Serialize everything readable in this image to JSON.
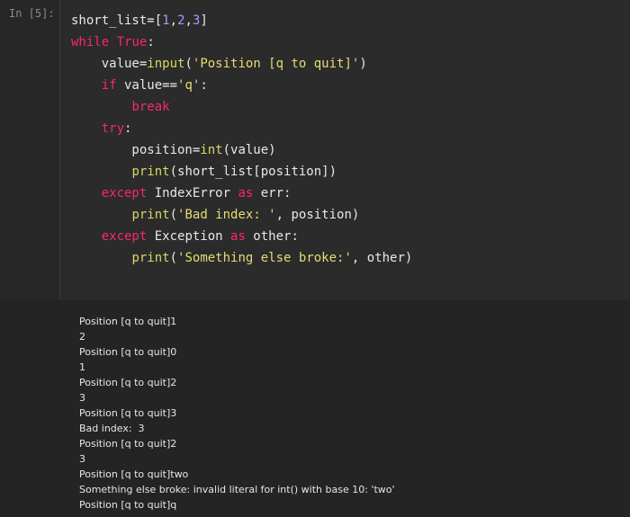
{
  "cell": {
    "prompt": "In [5]:",
    "code_lines": [
      [
        {
          "t": "short_list",
          "c": "plain"
        },
        {
          "t": "=",
          "c": "op"
        },
        {
          "t": "[",
          "c": "plain"
        },
        {
          "t": "1",
          "c": "num"
        },
        {
          "t": ",",
          "c": "plain"
        },
        {
          "t": "2",
          "c": "num"
        },
        {
          "t": ",",
          "c": "plain"
        },
        {
          "t": "3",
          "c": "num"
        },
        {
          "t": "]",
          "c": "plain"
        }
      ],
      [
        {
          "t": "while",
          "c": "kw"
        },
        {
          "t": " ",
          "c": "plain"
        },
        {
          "t": "True",
          "c": "kw"
        },
        {
          "t": ":",
          "c": "plain"
        }
      ],
      [
        {
          "t": "    value",
          "c": "plain"
        },
        {
          "t": "=",
          "c": "op"
        },
        {
          "t": "input",
          "c": "fn"
        },
        {
          "t": "(",
          "c": "plain"
        },
        {
          "t": "'Position [q to quit]'",
          "c": "str"
        },
        {
          "t": ")",
          "c": "plain"
        }
      ],
      [
        {
          "t": "    ",
          "c": "plain"
        },
        {
          "t": "if",
          "c": "kw"
        },
        {
          "t": " value",
          "c": "plain"
        },
        {
          "t": "==",
          "c": "op"
        },
        {
          "t": "'q'",
          "c": "str"
        },
        {
          "t": ":",
          "c": "plain"
        }
      ],
      [
        {
          "t": "        ",
          "c": "plain"
        },
        {
          "t": "break",
          "c": "kw"
        }
      ],
      [
        {
          "t": "    ",
          "c": "plain"
        },
        {
          "t": "try",
          "c": "kw"
        },
        {
          "t": ":",
          "c": "plain"
        }
      ],
      [
        {
          "t": "        position",
          "c": "plain"
        },
        {
          "t": "=",
          "c": "op"
        },
        {
          "t": "int",
          "c": "fn"
        },
        {
          "t": "(value)",
          "c": "plain"
        }
      ],
      [
        {
          "t": "        ",
          "c": "plain"
        },
        {
          "t": "print",
          "c": "fn"
        },
        {
          "t": "(short_list[position])",
          "c": "plain"
        }
      ],
      [
        {
          "t": "    ",
          "c": "plain"
        },
        {
          "t": "except",
          "c": "kw"
        },
        {
          "t": " IndexError ",
          "c": "plain"
        },
        {
          "t": "as",
          "c": "kw"
        },
        {
          "t": " err:",
          "c": "plain"
        }
      ],
      [
        {
          "t": "        ",
          "c": "plain"
        },
        {
          "t": "print",
          "c": "fn"
        },
        {
          "t": "(",
          "c": "plain"
        },
        {
          "t": "'Bad index: '",
          "c": "str"
        },
        {
          "t": ", position)",
          "c": "plain"
        }
      ],
      [
        {
          "t": "    ",
          "c": "plain"
        },
        {
          "t": "except",
          "c": "kw"
        },
        {
          "t": " Exception ",
          "c": "plain"
        },
        {
          "t": "as",
          "c": "kw"
        },
        {
          "t": " other:",
          "c": "plain"
        }
      ],
      [
        {
          "t": "        ",
          "c": "plain"
        },
        {
          "t": "print",
          "c": "fn"
        },
        {
          "t": "(",
          "c": "plain"
        },
        {
          "t": "'Something else broke:'",
          "c": "str"
        },
        {
          "t": ", other)",
          "c": "plain"
        }
      ]
    ],
    "output_lines": [
      "Position [q to quit]1",
      "2",
      "Position [q to quit]0",
      "1",
      "Position [q to quit]2",
      "3",
      "Position [q to quit]3",
      "Bad index:  3",
      "Position [q to quit]2",
      "3",
      "Position [q to quit]two",
      "Something else broke: invalid literal for int() with base 10: 'two'",
      "Position [q to quit]q"
    ]
  }
}
